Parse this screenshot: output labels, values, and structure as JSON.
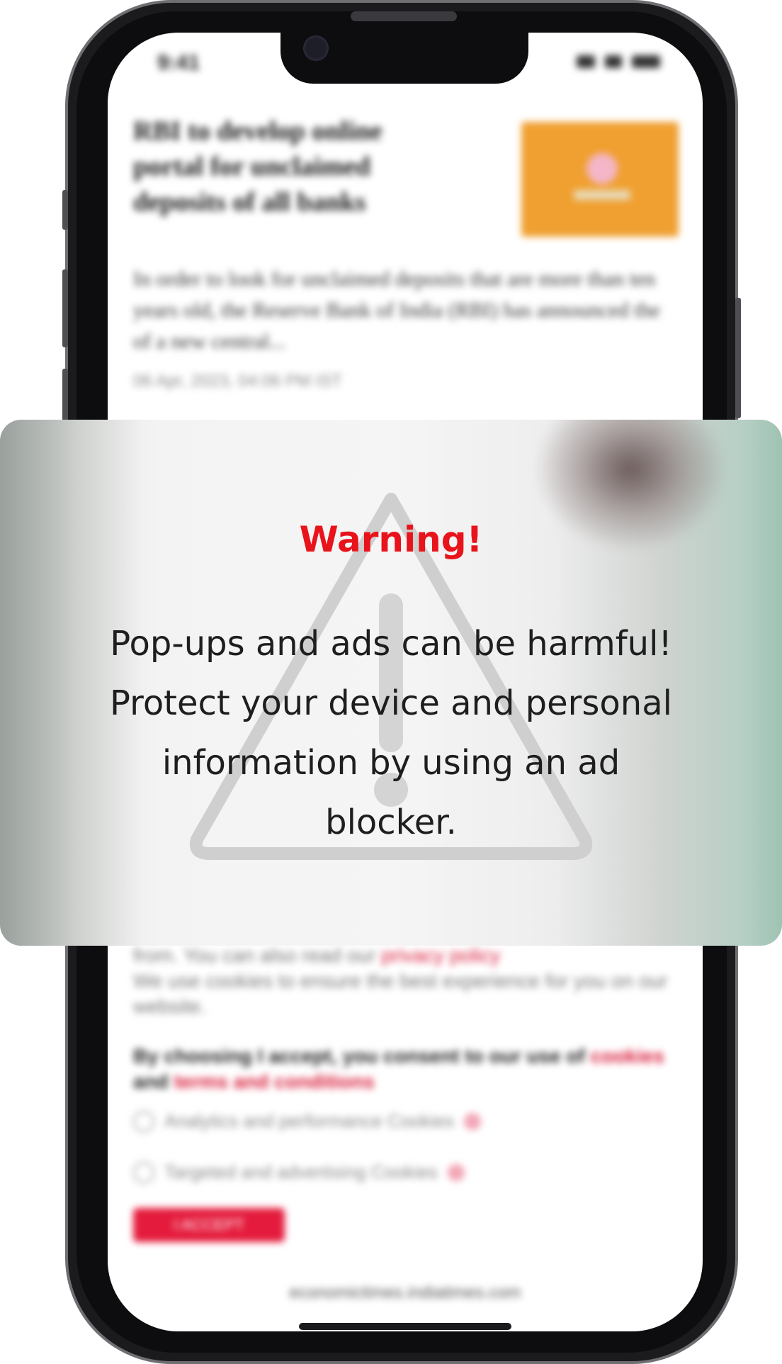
{
  "status_bar": {
    "time": "9:41"
  },
  "article": {
    "title": "RBI to develop online portal for unclaimed deposits of all banks",
    "summary": "In order to look for unclaimed deposits that are more than ten years old, the Reserve Bank of India (RBI) has announced the of a new central...",
    "date": "06 Apr, 2023, 04:06 PM IST"
  },
  "cookie_notice": {
    "text": "from. You can also read our",
    "privacy_link": "privacy policy",
    "text2": "We use cookies to ensure the best experience for you on our website.",
    "consent_prefix": "By choosing I accept, you consent to our use of",
    "cookies_link": "cookies",
    "consent_mid": "and",
    "terms_link": "terms and conditions",
    "option_analytics": "Analytics and performance Cookies",
    "option_targeted": "Targeted and advertising Cookies",
    "accept_label": "I ACCEPT"
  },
  "url_bar": {
    "url": "economictimes.indiatimes.com"
  },
  "warning": {
    "title": "Warning!",
    "message": "Pop-ups and ads can be harmful! Protect your device and personal information by using an ad blocker."
  },
  "colors": {
    "warning_title": "#e8131b",
    "accent": "#e41b3c"
  }
}
